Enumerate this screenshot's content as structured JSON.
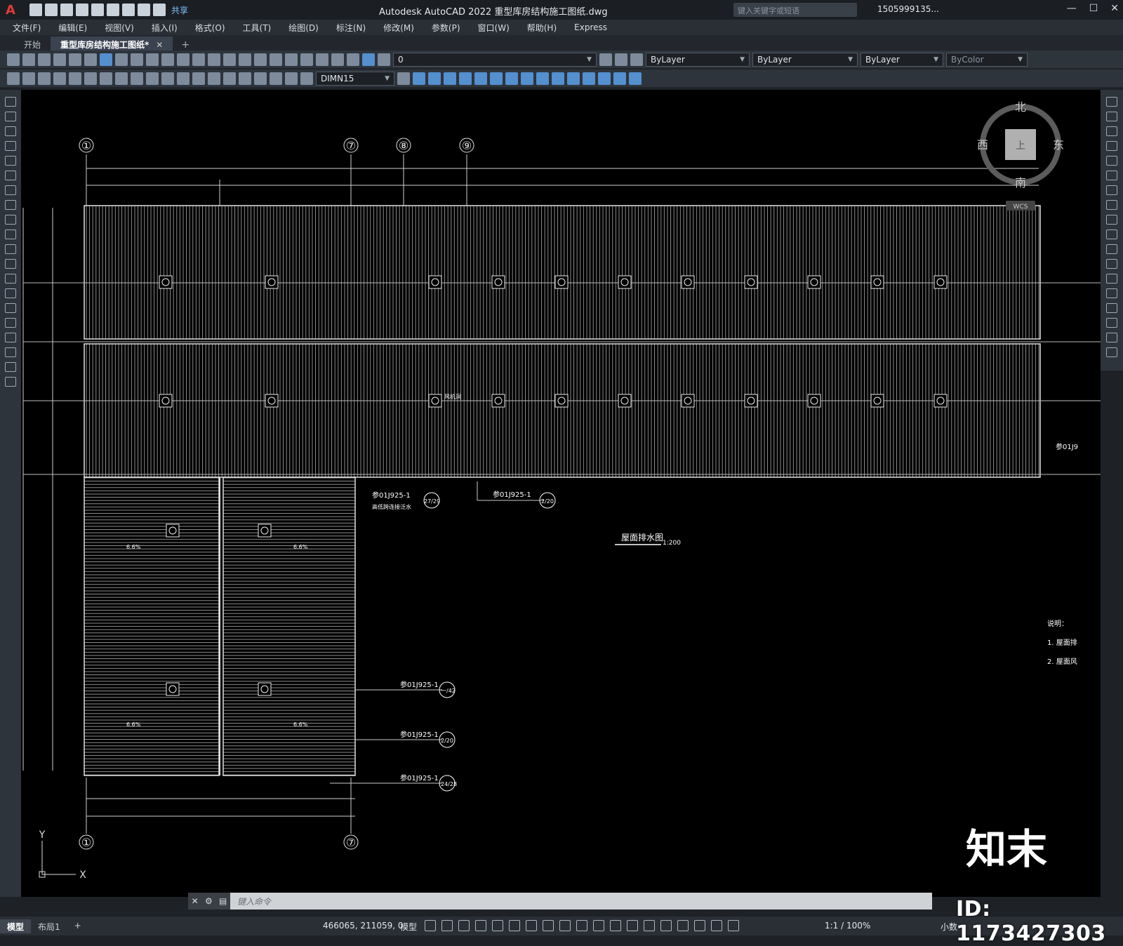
{
  "titlebar": {
    "logo": "A",
    "share": "共享",
    "title": "Autodesk AutoCAD 2022    重型库房结构施工图纸.dwg",
    "search_placeholder": "键入关键字或短语",
    "user": "1505999135...",
    "min": "—",
    "max": "☐",
    "close": "✕"
  },
  "menu": [
    "文件(F)",
    "编辑(E)",
    "视图(V)",
    "插入(I)",
    "格式(O)",
    "工具(T)",
    "绘图(D)",
    "标注(N)",
    "修改(M)",
    "参数(P)",
    "窗口(W)",
    "帮助(H)",
    "Express"
  ],
  "tabs": {
    "start": "开始",
    "active": "重型库房结构施工图纸*",
    "close": "✕",
    "add": "+"
  },
  "layers": {
    "layer": "0",
    "color": "ByLayer",
    "linetype": "ByLayer",
    "lineweight": "ByLayer",
    "plotstyle": "ByColor",
    "dimstyle": "DIMN15"
  },
  "viewcube": {
    "north": "北",
    "south": "南",
    "east": "东",
    "west": "西",
    "top": "上",
    "wcs": "WCS"
  },
  "drawing": {
    "axis_labels": [
      "①",
      "⑦",
      "⑧",
      "⑨"
    ],
    "axis_bottom": [
      "①",
      "⑦"
    ],
    "slope_label": "6.6%",
    "vent_label": "风机洞",
    "title": "屋面排水图",
    "scale": "1:200",
    "notes_head": "说明：",
    "note1": "1. 屋面排",
    "note2": "2. 屋面风",
    "ref_right": "参01J9",
    "ref1": "参01J925-1",
    "ref1_note": "高低跨连接泛水",
    "ref1_sym": "27/29",
    "ref2": "参01J925-1",
    "ref2_sym": "2/20",
    "ref3": "参01J925-1",
    "ref3_sym": "一/42",
    "ref4": "参01J925-1",
    "ref4_sym": "2/20",
    "ref5": "参01J925-1",
    "ref5_sym": "24/28",
    "ucs_y": "Y",
    "ucs_x": "X",
    "logo_text": "知末"
  },
  "command": {
    "close": "✕",
    "placeholder": "键入命令"
  },
  "status": {
    "model_tab": "模型",
    "layout_tab": "布局1",
    "add": "+",
    "coords": "466065, 211059, 0",
    "model": "模型",
    "scale": "1:1 / 100%",
    "units": "小数"
  },
  "watermark_id": "ID: 1173427303"
}
